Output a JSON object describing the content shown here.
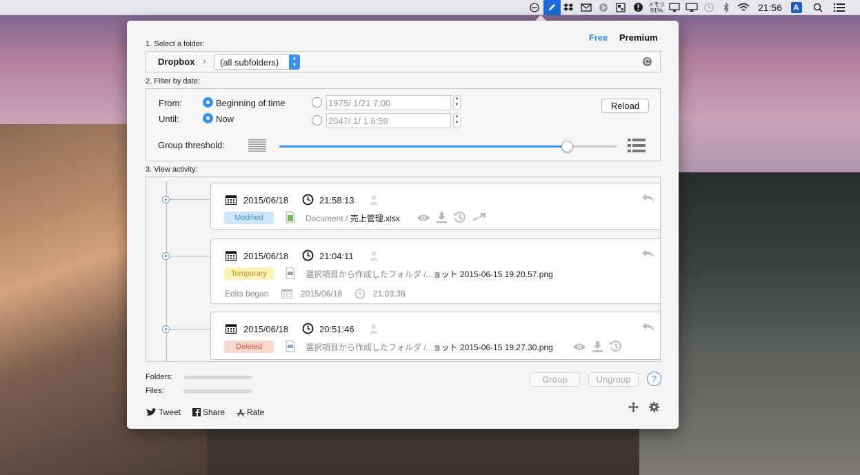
{
  "menubar": {
    "clock": "21:56",
    "memory_label": "メモリ",
    "memory_value": "91%",
    "input_label": "A"
  },
  "plans": {
    "free": "Free",
    "premium": "Premium"
  },
  "section1": {
    "label": "1. Select a folder:",
    "folder": "Dropbox",
    "subfolder": "(all subfolders)"
  },
  "section2": {
    "label": "2. Filter by date:",
    "from_label": "From:",
    "until_label": "Until:",
    "from_option": "Beginning of time",
    "until_option": "Now",
    "from_date": "1975/  1/21   7:00",
    "until_date": "2047/  1/  1   6:59",
    "reload": "Reload",
    "threshold_label": "Group threshold:",
    "threshold_level": 0.85
  },
  "section3": {
    "label": "3. View activity:"
  },
  "activities": [
    {
      "date": "2015/06/18",
      "time": "21:58:13",
      "status": "Modified",
      "status_color": "#cfe5fb",
      "status_text_color": "#4a8fd8",
      "path_prefix": "Document / ",
      "filename": "売上管理.xlsx"
    },
    {
      "date": "2015/06/18",
      "time": "21:04:11",
      "status": "Temporary",
      "status_color": "#fbf3b5",
      "status_text_color": "#b8962b",
      "path_prefix": "選択項目から作成したフォルダ /...",
      "filename": "ョット 2015-06-15 19.20.57.png",
      "edits_label": "Edits began",
      "edits_date": "2015/06/18",
      "edits_time": "21:03:38"
    },
    {
      "date": "2015/06/18",
      "time": "20:51:46",
      "status": "Deleted",
      "status_color": "#fbd9d0",
      "status_text_color": "#d9583c",
      "path_prefix": "選択項目から作成したフォルダ /...",
      "filename": "ョット 2015-06-15 19.27.30.png"
    }
  ],
  "footer": {
    "folders_label": "Folders:",
    "files_label": "Files:",
    "group": "Group",
    "ungroup": "Ungroup",
    "help": "?",
    "tweet": "Tweet",
    "share": "Share",
    "rate": "Rate"
  }
}
